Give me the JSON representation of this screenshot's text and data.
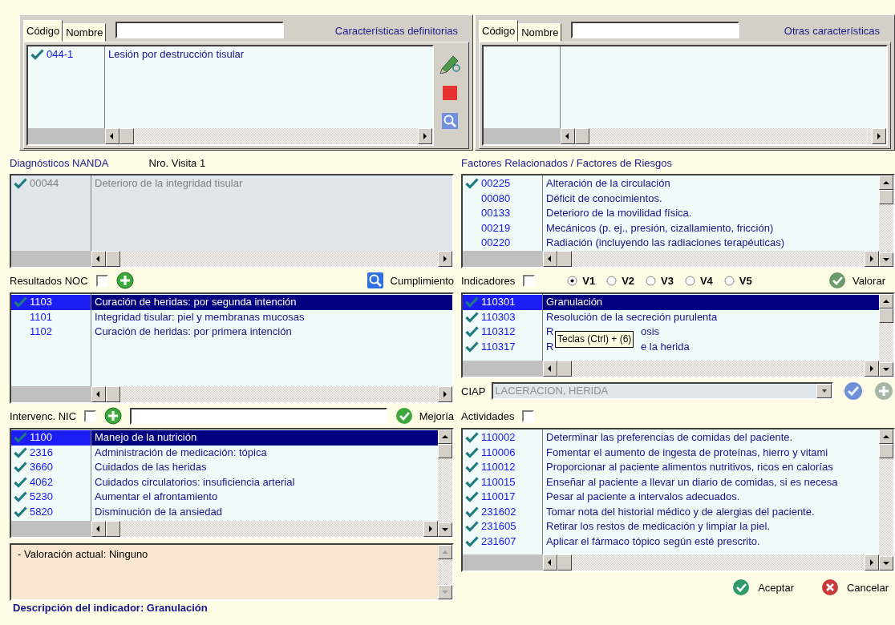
{
  "top_panels": [
    {
      "kind": "tools",
      "tabs": [
        {
          "label": "Código",
          "selected": true
        },
        {
          "label": "Nombre",
          "selected": false
        }
      ],
      "title": "Características definitorias",
      "rows": [
        {
          "checked": true,
          "selected": false,
          "code": "044-1",
          "text": "Lesión por destrucción tisular"
        }
      ]
    },
    {
      "kind": "plain",
      "tabs": [
        {
          "label": "Código",
          "selected": true
        },
        {
          "label": "Nombre",
          "selected": false
        }
      ],
      "title": "Otras características"
    }
  ],
  "nanda": {
    "title": "Diagnósticos NANDA",
    "visit": "Nro. Visita 1",
    "disabled": true,
    "rows": [
      {
        "checked": true,
        "selected": false,
        "code": "00044",
        "text": "Deterioro de la integridad tisular"
      }
    ]
  },
  "factors": {
    "title": "Factores Relacionados / Factores de Riesgos",
    "rows": [
      {
        "checked": true,
        "selected": false,
        "code": "00225",
        "text": "Alteración de la circulación"
      },
      {
        "checked": false,
        "selected": false,
        "code": "00080",
        "text": "Déficit de conocimientos."
      },
      {
        "checked": false,
        "selected": false,
        "code": "00133",
        "text": "Deterioro de la movilidad física."
      },
      {
        "checked": false,
        "selected": false,
        "code": "00219",
        "text": "Mecánicos (p. ej., presión, cizallamiento, fricción)"
      },
      {
        "checked": false,
        "selected": false,
        "code": "00220",
        "text": "Radiación (incluyendo las radiaciones terapéuticas)"
      }
    ]
  },
  "noc": {
    "title": "Resultados NOC",
    "checked": false,
    "button": "Cumplimiento",
    "rows": [
      {
        "checked": true,
        "selected": true,
        "code": "1103",
        "text": "Curación de heridas: por segunda intención"
      },
      {
        "checked": false,
        "selected": false,
        "code": "1101",
        "text": "Integridad tisular: piel y membranas mucosas"
      },
      {
        "checked": false,
        "selected": false,
        "code": "1102",
        "text": "Curación de heridas: por primera intención"
      }
    ]
  },
  "indicators": {
    "title": "Indicadores",
    "checked": false,
    "versions": [
      {
        "label": "V1",
        "selected": true
      },
      {
        "label": "V2",
        "selected": false
      },
      {
        "label": "V3",
        "selected": false
      },
      {
        "label": "V4",
        "selected": false
      },
      {
        "label": "V5",
        "selected": false
      }
    ],
    "button": "Valorar",
    "rows": [
      {
        "checked": true,
        "selected": true,
        "code": "110301",
        "text": "Granulación"
      },
      {
        "checked": true,
        "selected": false,
        "code": "110303",
        "text": "Resolución de la secreción purulenta"
      },
      {
        "checked": true,
        "selected": false,
        "code": "110312",
        "text": "R",
        "text_end": "osis"
      },
      {
        "checked": true,
        "selected": false,
        "code": "110317",
        "text": "R",
        "text_end": "e la herida"
      }
    ],
    "tooltip": "Teclas (Ctrl) + (6)"
  },
  "ciap": {
    "label": "CIAP",
    "value": "LACERACION, HERIDA",
    "disabled": true
  },
  "nic": {
    "title": "Intervenc. NIC",
    "checked": false,
    "button": "Mejoría",
    "rows": [
      {
        "checked": true,
        "selected": true,
        "code": "1100",
        "text": "Manejo de la nutrición"
      },
      {
        "checked": true,
        "selected": false,
        "code": "2316",
        "text": "Administración de medicación: tópica"
      },
      {
        "checked": true,
        "selected": false,
        "code": "3660",
        "text": "Cuidados de las heridas"
      },
      {
        "checked": true,
        "selected": false,
        "code": "4062",
        "text": "Cuidados circulatorios: insuficiencia arterial"
      },
      {
        "checked": true,
        "selected": false,
        "code": "5230",
        "text": "Aumentar el afrontamiento"
      },
      {
        "checked": true,
        "selected": false,
        "code": "5820",
        "text": "Disminución de la ansiedad"
      }
    ]
  },
  "activities": {
    "title": "Actividades",
    "checked": false,
    "rows": [
      {
        "checked": true,
        "selected": false,
        "code": "110002",
        "text": "Determinar las preferencias de comidas del paciente."
      },
      {
        "checked": true,
        "selected": false,
        "code": "110006",
        "text": "Fomentar el aumento de ingesta de proteínas, hierro y vitami"
      },
      {
        "checked": true,
        "selected": false,
        "code": "110012",
        "text": "Proporcionar al paciente alimentos nutritivos, ricos en calorías"
      },
      {
        "checked": true,
        "selected": false,
        "code": "110015",
        "text": "Enseñar al paciente a llevar un diario de comidas, si es necesa"
      },
      {
        "checked": true,
        "selected": false,
        "code": "110017",
        "text": "Pesar al paciente a intervalos adecuados."
      },
      {
        "checked": true,
        "selected": false,
        "code": "231602",
        "text": "Tomar nota del historial médico y de alergias del paciente."
      },
      {
        "checked": true,
        "selected": false,
        "code": "231605",
        "text": "Retirar los restos de medicación y limpiar la piel."
      },
      {
        "checked": true,
        "selected": false,
        "code": "231607",
        "text": "Aplicar el fármaco tópico según esté prescrito."
      }
    ]
  },
  "notes": {
    "text": "- Valoración actual: Ninguno"
  },
  "description": "Descripción del indicador: Granulación",
  "buttons": [
    {
      "label": "Aceptar",
      "kind": "accept"
    },
    {
      "label": "Cancelar",
      "kind": "cancel"
    }
  ]
}
